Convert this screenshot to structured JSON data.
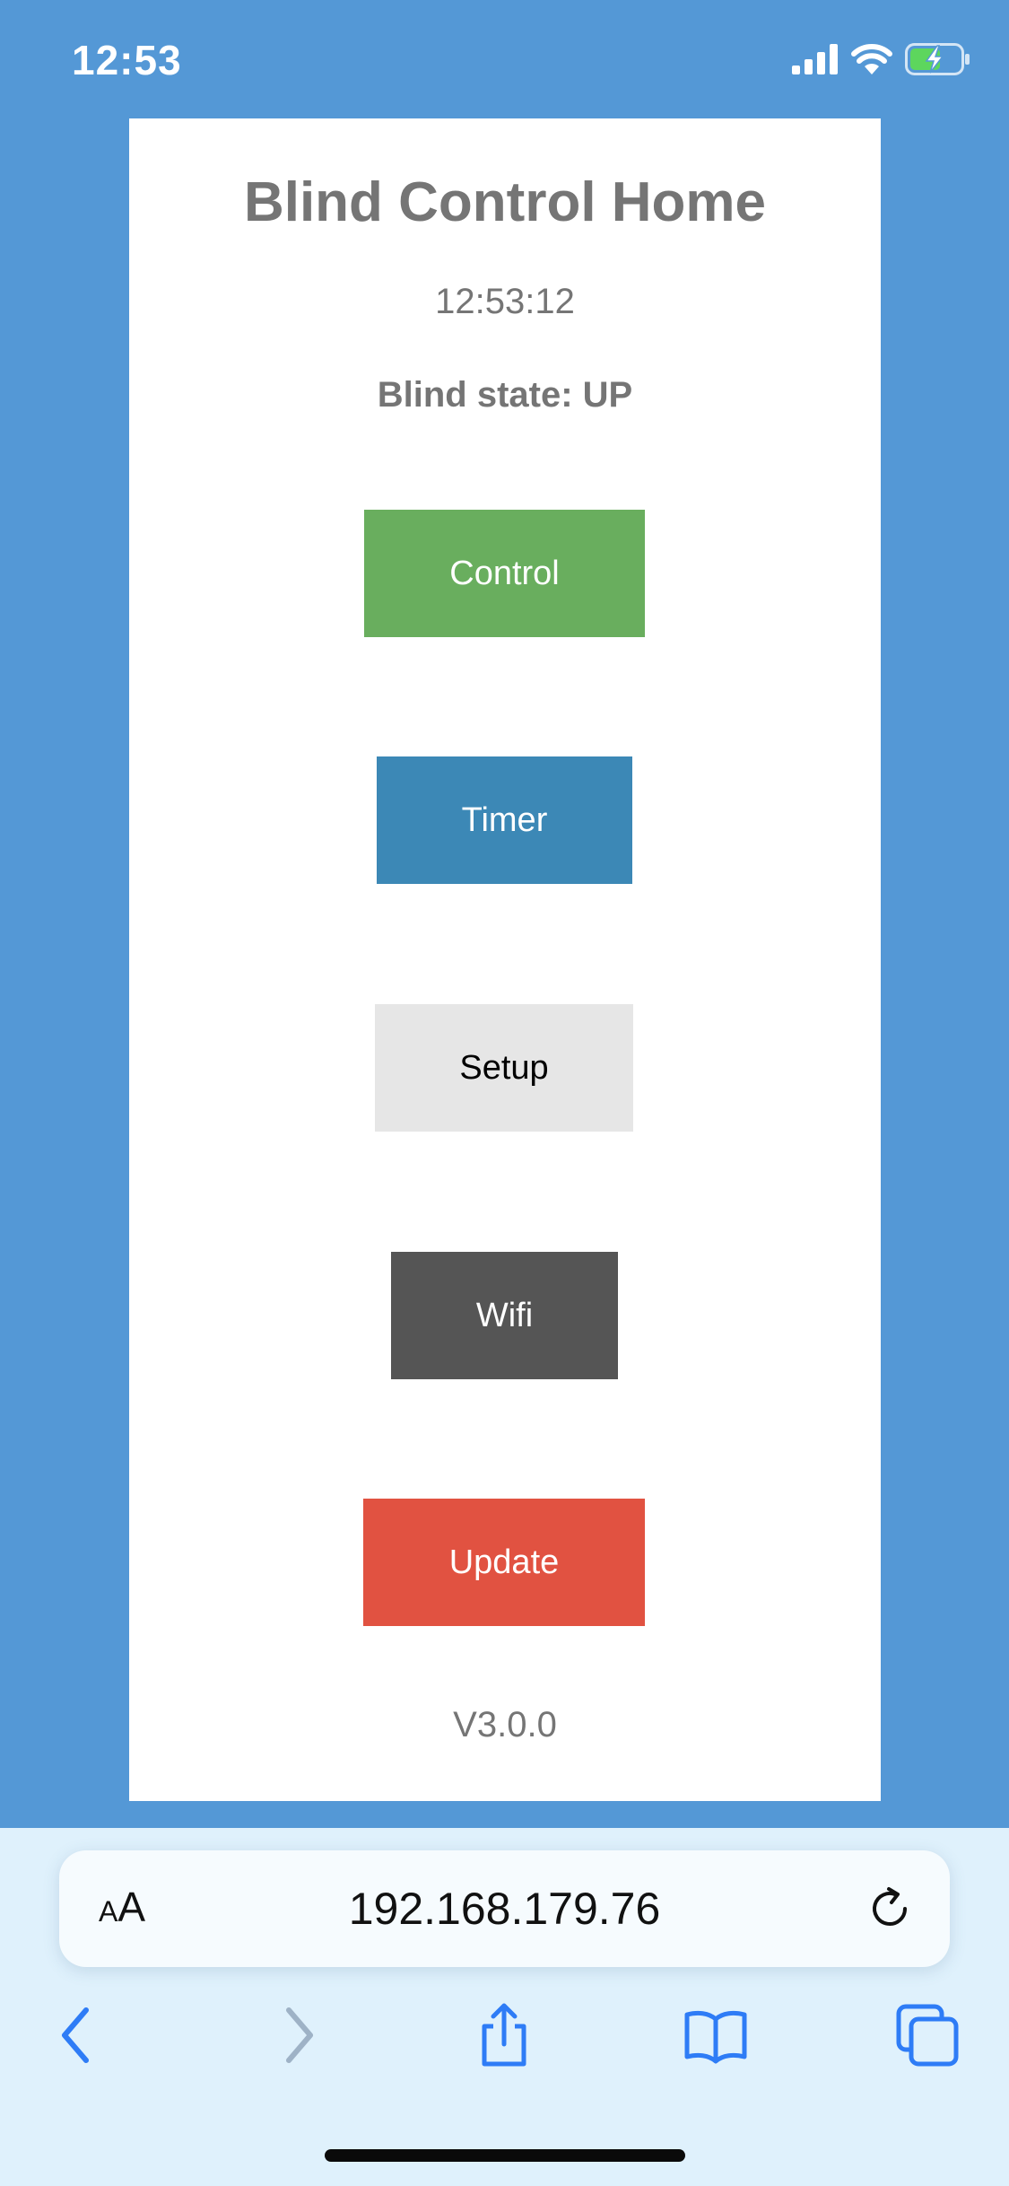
{
  "status_bar": {
    "time": "12:53",
    "icons": [
      "cellular-signal-icon",
      "wifi-icon",
      "battery-charging-icon"
    ]
  },
  "page": {
    "title": "Blind Control Home",
    "clock": "12:53:12",
    "blind_state": "Blind state: UP",
    "buttons": {
      "control": "Control",
      "timer": "Timer",
      "setup": "Setup",
      "wifi": "Wifi",
      "update": "Update"
    },
    "version": "V3.0.0"
  },
  "browser": {
    "text_size_label_small": "A",
    "text_size_label_large": "A",
    "url": "192.168.179.76",
    "toolbar": [
      "back-icon",
      "forward-icon",
      "share-icon",
      "bookmarks-icon",
      "tabs-icon"
    ]
  },
  "colors": {
    "background": "#5498d6",
    "control": "#69ae5e",
    "timer": "#3c88b6",
    "setup": "#e6e6e6",
    "wifi": "#555555",
    "update": "#e15241"
  }
}
